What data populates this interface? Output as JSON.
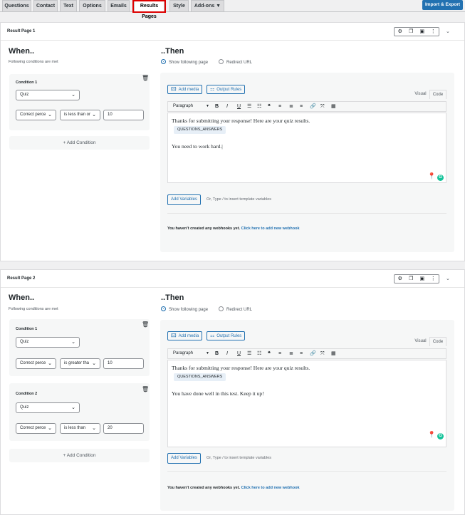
{
  "nav": {
    "tabs": [
      {
        "label": "Questions"
      },
      {
        "label": "Contact"
      },
      {
        "label": "Text"
      },
      {
        "label": "Options"
      },
      {
        "label": "Emails"
      },
      {
        "label": "Results Pages"
      },
      {
        "label": "Style"
      },
      {
        "label": "Add-ons ▼"
      }
    ],
    "active_tab": "Results Pages",
    "import_export_label": "Import & Export"
  },
  "icons": {
    "settings": "gear-icon",
    "duplicate": "copy-icon",
    "save": "save-icon",
    "menu": "more-vertical-icon",
    "collapse": "chevron-down-icon",
    "trash": "trash-icon"
  },
  "colors": {
    "accent": "#2271b1",
    "highlight_box": "#dd0000",
    "grammarly": "#15c39a"
  },
  "result_pages": [
    {
      "title": "Result Page 1",
      "when_title": "When..",
      "when_sub": "Following conditions are met",
      "conditions": [
        {
          "label": "Condition 1",
          "source": "Quiz",
          "metric": "Correct perce",
          "operator": "is less than or",
          "value": "10"
        }
      ],
      "add_condition": "+ Add Condition",
      "then_title": "..Then",
      "radio_show": "Show following page",
      "radio_redirect": "Redirect URL",
      "add_media": "Add media",
      "output_rules": "Output Rules",
      "tab_visual": "Visual",
      "tab_code": "Code",
      "format": "Paragraph",
      "editor_line1": "Thanks for submitting your response! Here are your quiz results.",
      "editor_tag": "QUESTIONS_ANSWERS",
      "editor_line2": "You need to work hard.",
      "add_variables": "Add Variables",
      "variables_hint": "Or, Type / to insert template variables",
      "webhook_text": "You haven't created any webhooks yet.",
      "webhook_link": "Click here to add new webhook"
    },
    {
      "title": "Result Page 2",
      "when_title": "When..",
      "when_sub": "Following conditions are met",
      "conditions": [
        {
          "label": "Condition 1",
          "source": "Quiz",
          "metric": "Correct perce",
          "operator": "is greater tha",
          "value": "10"
        },
        {
          "label": "Condition 2",
          "source": "Quiz",
          "metric": "Correct perce",
          "operator": "is less than",
          "value": "20"
        }
      ],
      "add_condition": "+ Add Condition",
      "then_title": "..Then",
      "radio_show": "Show following page",
      "radio_redirect": "Redirect URL",
      "add_media": "Add media",
      "output_rules": "Output Rules",
      "tab_visual": "Visual",
      "tab_code": "Code",
      "format": "Paragraph",
      "editor_line1": "Thanks for submitting your response! Here are your quiz results.",
      "editor_tag": "QUESTIONS_ANSWERS",
      "editor_line2": "You have done well in this test. Keep it up!",
      "add_variables": "Add Variables",
      "variables_hint": "Or, Type / to insert template variables",
      "webhook_text": "You haven't created any webhooks yet.",
      "webhook_link": "Click here to add new webhook"
    }
  ]
}
